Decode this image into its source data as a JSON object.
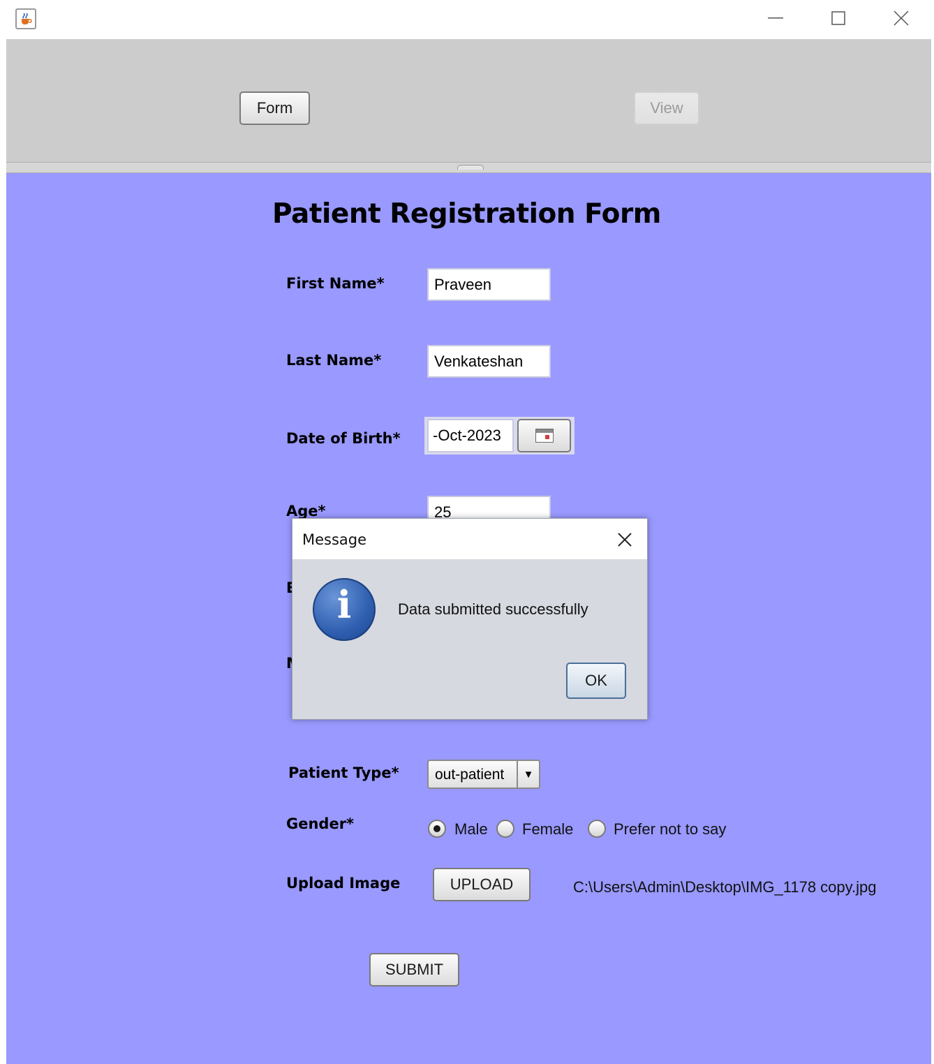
{
  "window": {
    "minimize": "–",
    "maximize": "□",
    "close": "✕"
  },
  "nav": {
    "form_button": "Form",
    "view_button": "View"
  },
  "form": {
    "title": "Patient Registration Form",
    "first_name": {
      "label": "First Name*",
      "value": "Praveen"
    },
    "last_name": {
      "label": "Last Name*",
      "value": "Venkateshan"
    },
    "dob": {
      "label": "Date of Birth*",
      "value": "-Oct-2023"
    },
    "age": {
      "label": "Age*",
      "value": "25"
    },
    "patient_type": {
      "label": "Patient Type*",
      "selected": "out-patient"
    },
    "gender": {
      "label": "Gender*",
      "options": [
        "Male",
        "Female",
        "Prefer not to say"
      ],
      "selected": "Male"
    },
    "upload": {
      "label": "Upload Image",
      "button": "UPLOAD",
      "path": "C:\\Users\\Admin\\Desktop\\IMG_1178 copy.jpg"
    },
    "submit": "SUBMIT"
  },
  "dialog": {
    "title": "Message",
    "close": "✕",
    "icon": "information-icon",
    "message": "Data submitted successfully",
    "ok": "OK"
  },
  "hidden_label_fragments": [
    "E",
    "M"
  ]
}
